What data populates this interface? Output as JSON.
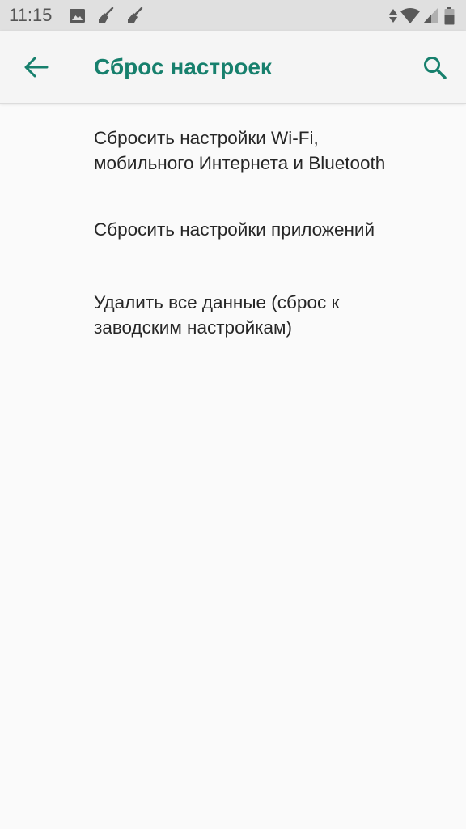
{
  "status_bar": {
    "time": "11:15",
    "icons_left": [
      "image-icon",
      "broom-icon",
      "broom-icon"
    ],
    "icons_right": [
      "data-arrows-icon",
      "wifi-icon",
      "signal-icon",
      "battery-icon"
    ]
  },
  "app_bar": {
    "title": "Сброс настроек",
    "back_icon": "arrow-back-icon",
    "search_icon": "search-icon"
  },
  "items": [
    {
      "line1": "Сбросить настройки Wi-Fi,",
      "line2": "мобильного Интернета и Bluetooth"
    },
    {
      "line1": "Сбросить настройки приложений",
      "line2": ""
    },
    {
      "line1": "Удалить все данные (сброс к",
      "line2": "заводским настройкам)"
    }
  ],
  "colors": {
    "accent": "#17806d",
    "background": "#fafafa",
    "status_bar": "#e0e0e0",
    "app_bar": "#f5f5f5",
    "text": "#262626"
  }
}
